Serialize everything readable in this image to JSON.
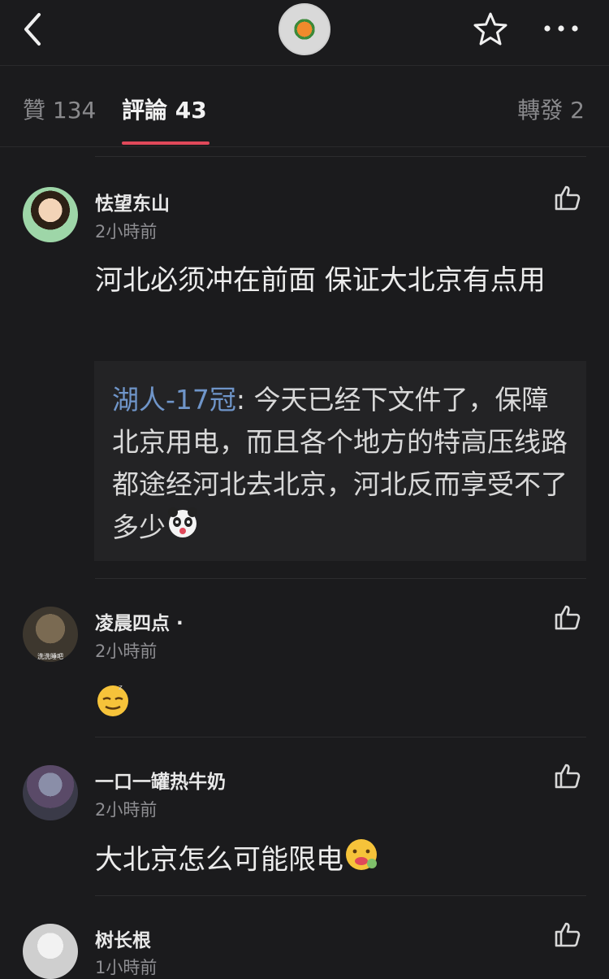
{
  "tabs": {
    "likes": "贊 134",
    "comments": "評論 43",
    "forwards": "轉發 2"
  },
  "comments": [
    {
      "name": "怯望东山",
      "time": "2小時前",
      "text": "河北必须冲在前面 保证大北京有点用",
      "reply": {
        "author": "湖人-17冠",
        "separator": ": ",
        "text": "今天已经下文件了，保障北京用电，而且各个地方的特高压线路都途经河北去北京，河北反而享受不了多少"
      }
    },
    {
      "name": "凌晨四点 ·",
      "time": "2小時前",
      "avatar_caption": "洗洗睡吧",
      "text": ""
    },
    {
      "name": "一口一罐热牛奶",
      "time": "2小時前",
      "text": "大北京怎么可能限电"
    },
    {
      "name": "树长根",
      "time": "1小時前"
    }
  ],
  "icons": {
    "back": "chevron-left-icon",
    "favorite": "star-icon",
    "more": "more-dots-icon",
    "like": "thumb-up-icon"
  },
  "colors": {
    "accent": "#e0485a",
    "link": "#6f95c9",
    "background": "#1b1b1d"
  }
}
